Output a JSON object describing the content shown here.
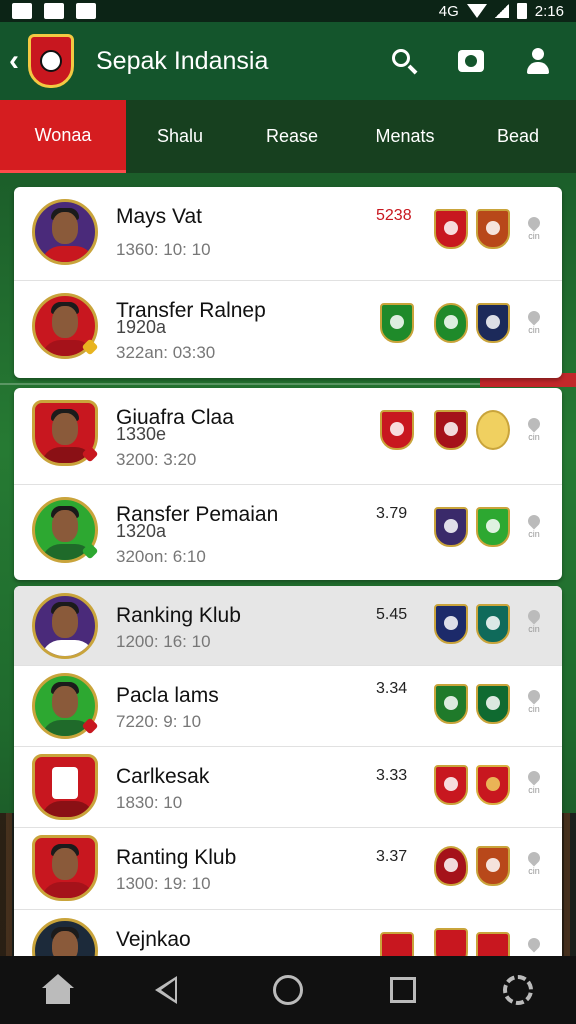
{
  "status_bar": {
    "network": "4G",
    "time": "2:16"
  },
  "app_bar": {
    "title": "Sepak Indansia"
  },
  "tabs": [
    {
      "label": "Wonaa",
      "active": true
    },
    {
      "label": "Shalu",
      "active": false
    },
    {
      "label": "Rease",
      "active": false
    },
    {
      "label": "Menats",
      "active": false
    },
    {
      "label": "Bead",
      "active": false
    }
  ],
  "cards": [
    {
      "rows": [
        {
          "name": "Mays Vat",
          "time": "1360: 10: 10",
          "score": "5238",
          "crest_colors": [
            "#c8171f",
            "#b8481a"
          ]
        },
        {
          "name": "Transfer Ralnep",
          "sub": "1920a",
          "time": "322an: 03:30",
          "crest_colors": [
            "#1f8a2a",
            "#1f8a2a",
            "#1c2a5a"
          ]
        }
      ]
    },
    {
      "rows": [
        {
          "name": "Giuafra Claa",
          "sub": "1330e",
          "time": "3200: 3:20",
          "crest_colors": [
            "#c8171f",
            "#a5121a",
            "#f0d060"
          ]
        },
        {
          "name": "Ransfer Pemaian",
          "sub": "1320a",
          "time": "320on: 6:10",
          "score": "3.79",
          "crest_colors": [
            "#3a2a6a",
            "#2da831"
          ]
        }
      ]
    },
    {
      "rows": [
        {
          "name": "Ranking Klub",
          "time": "1200: 16: 10",
          "score": "5.45",
          "crest_colors": [
            "#1c2a6a",
            "#0f6a5a"
          ]
        },
        {
          "name": "Pacla lams",
          "time": "7220: 9: 10",
          "score": "3.34",
          "crest_colors": [
            "#1f7a2a",
            "#0f6a30"
          ]
        },
        {
          "name": "Carlkesak",
          "time": "1830: 10",
          "score": "3.33",
          "crest_colors": [
            "#c8171f",
            "#c8171f"
          ]
        },
        {
          "name": "Ranting Klub",
          "time": "1300: 19: 10",
          "score": "3.37",
          "crest_colors": [
            "#a5121a",
            "#b8481a"
          ]
        },
        {
          "name": "Vejnkao",
          "crest_colors": [
            "#c8171f",
            "#c8171f",
            "#c8171f"
          ]
        }
      ]
    }
  ],
  "colors": {
    "header_green": "#14552c",
    "tab_active_red": "#d51d20",
    "score_red": "#c8171f"
  },
  "icons": [
    "back-arrow-icon",
    "club-logo",
    "search-icon",
    "camera-icon",
    "user-icon",
    "home-icon",
    "nav-back-icon",
    "nav-home-circle-icon",
    "recents-icon",
    "settings-icon"
  ]
}
